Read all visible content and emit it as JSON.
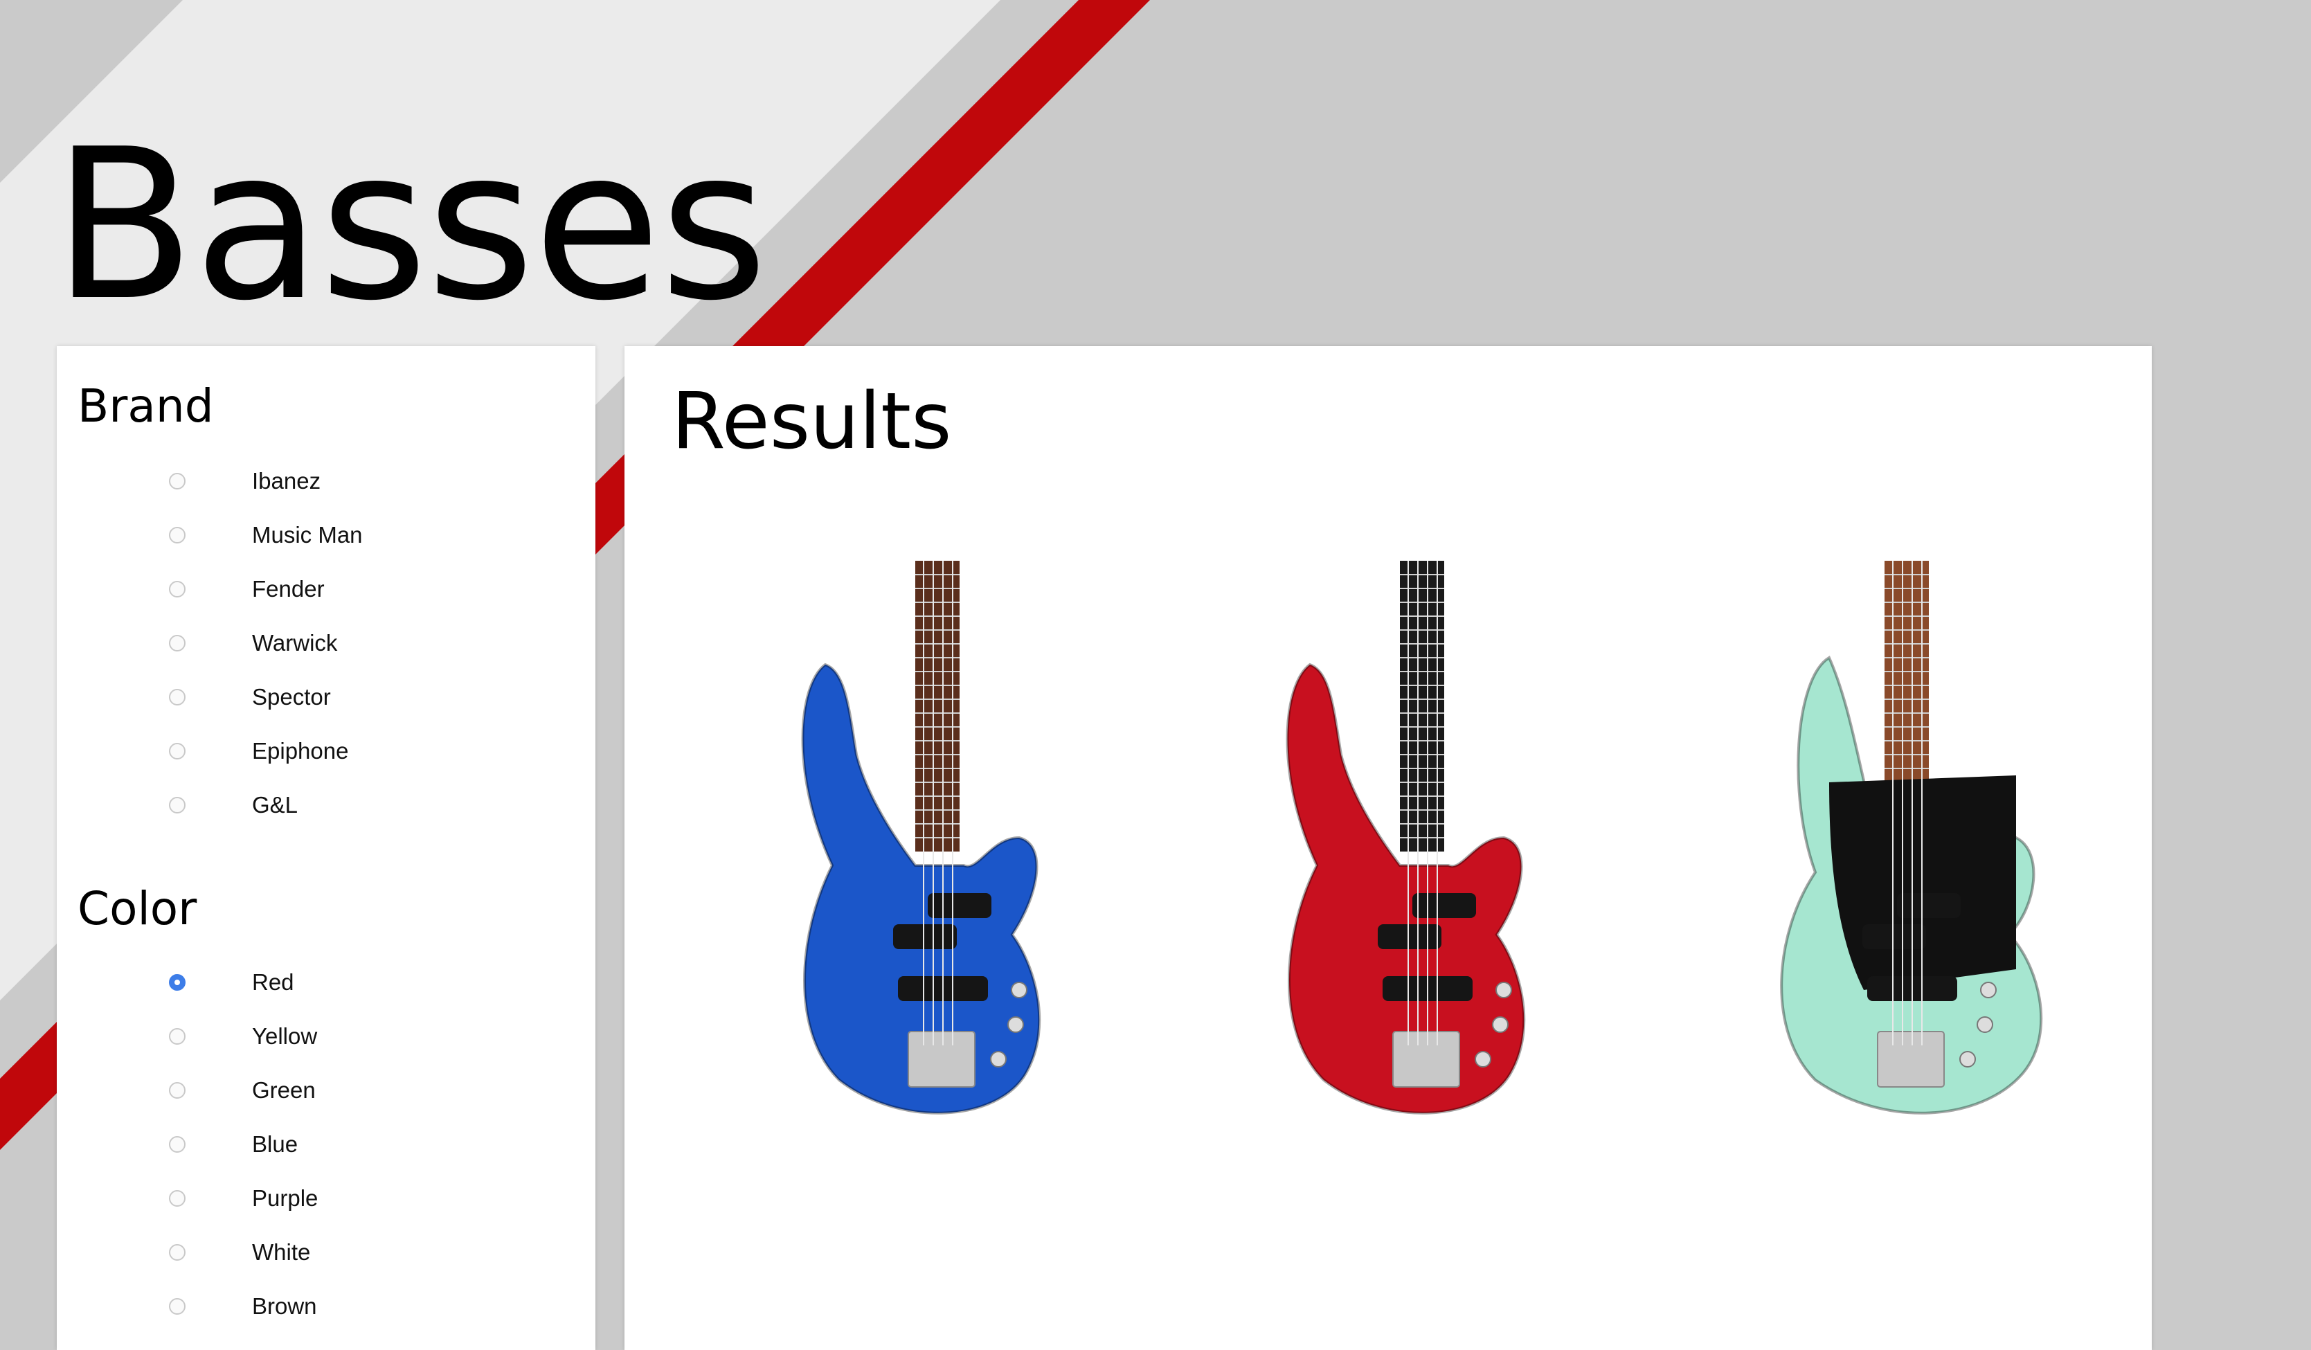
{
  "page": {
    "title": "Basses",
    "accent_color": "#c0070b",
    "background_color": "#cacaca"
  },
  "filters": {
    "brand": {
      "title": "Brand",
      "options": [
        {
          "label": "Ibanez",
          "checked": false
        },
        {
          "label": "Music Man",
          "checked": false
        },
        {
          "label": "Fender",
          "checked": false
        },
        {
          "label": "Warwick",
          "checked": false
        },
        {
          "label": "Spector",
          "checked": false
        },
        {
          "label": "Epiphone",
          "checked": false
        },
        {
          "label": "G&L",
          "checked": false
        }
      ]
    },
    "color": {
      "title": "Color",
      "options": [
        {
          "label": "Red",
          "checked": true
        },
        {
          "label": "Yellow",
          "checked": false
        },
        {
          "label": "Green",
          "checked": false
        },
        {
          "label": "Blue",
          "checked": false
        },
        {
          "label": "Purple",
          "checked": false
        },
        {
          "label": "White",
          "checked": false
        },
        {
          "label": "Brown",
          "checked": false
        }
      ]
    }
  },
  "results": {
    "title": "Results",
    "products": [
      {
        "image": "blue-bass-guitar",
        "body_color": "#1b56c9"
      },
      {
        "image": "red-bass-guitar",
        "body_color": "#c8101f"
      },
      {
        "image": "seafoam-green-bass-guitar",
        "body_color": "#a6e6d0"
      }
    ]
  }
}
